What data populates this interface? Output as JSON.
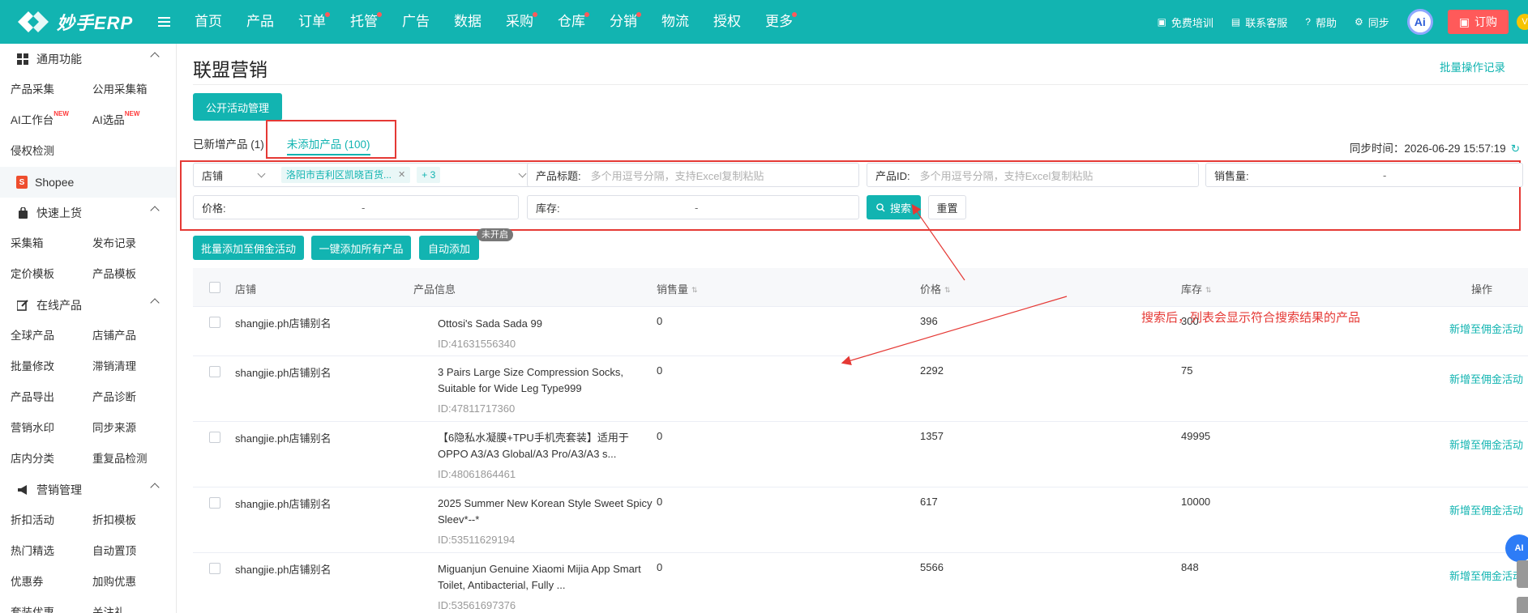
{
  "app": {
    "logo_text": "妙手ERP"
  },
  "nav": {
    "items": [
      {
        "label": "首页",
        "dot": false
      },
      {
        "label": "产品",
        "dot": false
      },
      {
        "label": "订单",
        "dot": true
      },
      {
        "label": "托管",
        "dot": true
      },
      {
        "label": "广告",
        "dot": false
      },
      {
        "label": "数据",
        "dot": false
      },
      {
        "label": "采购",
        "dot": true
      },
      {
        "label": "仓库",
        "dot": true
      },
      {
        "label": "分销",
        "dot": true
      },
      {
        "label": "物流",
        "dot": false
      },
      {
        "label": "授权",
        "dot": false
      },
      {
        "label": "更多",
        "dot": true
      }
    ],
    "right": {
      "training": "免费培训",
      "support": "联系客服",
      "help": "帮助",
      "sync": "同步",
      "ai_label": "Ai",
      "order": "订购",
      "vip": "V"
    },
    "accent_color": "#12b4b1"
  },
  "sidebar": {
    "sections": [
      {
        "title": "通用功能",
        "icon": "grid-icon",
        "links": [
          {
            "label": "产品采集"
          },
          {
            "label": "公用采集箱"
          },
          {
            "label": "AI工作台",
            "badge": "NEW"
          },
          {
            "label": "AI选品",
            "badge": "NEW"
          }
        ],
        "extra": "侵权检测"
      },
      {
        "title": "Shopee",
        "icon": "shopee-icon",
        "platform": true
      },
      {
        "title": "快速上货",
        "icon": "bag-icon",
        "links": [
          {
            "label": "采集箱"
          },
          {
            "label": "发布记录"
          },
          {
            "label": "定价模板"
          },
          {
            "label": "产品模板"
          }
        ]
      },
      {
        "title": "在线产品",
        "icon": "edit-icon",
        "links": [
          {
            "label": "全球产品"
          },
          {
            "label": "店铺产品"
          },
          {
            "label": "批量修改"
          },
          {
            "label": "滞销清理"
          },
          {
            "label": "产品导出"
          },
          {
            "label": "产品诊断"
          },
          {
            "label": "营销水印"
          },
          {
            "label": "同步来源"
          },
          {
            "label": "店内分类"
          },
          {
            "label": "重复品检测"
          }
        ]
      },
      {
        "title": "营销管理",
        "icon": "megaphone-icon",
        "links": [
          {
            "label": "折扣活动"
          },
          {
            "label": "折扣模板"
          },
          {
            "label": "热门精选"
          },
          {
            "label": "自动置顶"
          },
          {
            "label": "优惠券"
          },
          {
            "label": "加购优惠"
          },
          {
            "label": "套装优惠"
          },
          {
            "label": "关注礼"
          }
        ]
      }
    ]
  },
  "main": {
    "title": "联盟营销",
    "batch_log": "批量操作记录",
    "public_activity_button": "公开活动管理",
    "tabs": [
      {
        "label": "已新增产品 (1)",
        "active": false
      },
      {
        "label": "未添加产品 (100)",
        "active": true
      }
    ],
    "sync_time_label": "同步时间：",
    "sync_time_value": "2026-06-29 15:57:19",
    "filters": {
      "store_label": "店铺",
      "store_tag": "洛阳市吉利区凯晓百货...",
      "store_more": "+ 3",
      "title_label": "产品标题:",
      "title_placeholder": "多个用逗号分隔，支持Excel复制粘贴",
      "id_label": "产品ID:",
      "id_placeholder": "多个用逗号分隔，支持Excel复制粘贴",
      "sales_label": "销售量:",
      "price_label": "价格:",
      "stock_label": "库存:",
      "range_sep": "-",
      "search": "搜索",
      "reset": "重置"
    },
    "actions": {
      "batch_add": "批量添加至佣金活动",
      "add_all": "一键添加所有产品",
      "auto_add": "自动添加",
      "auto_badge": "未开启"
    },
    "table": {
      "headers": {
        "store": "店铺",
        "product": "产品信息",
        "sales": "销售量",
        "price": "价格",
        "stock": "库存",
        "op": "操作"
      },
      "rows": [
        {
          "store": "shangjie.ph店铺别名",
          "title": "Ottosi's Sada Sada 99",
          "id": "ID:41631556340",
          "sales": "0",
          "price": "396",
          "stock": "300",
          "action": "新增至佣金活动"
        },
        {
          "store": "shangjie.ph店铺别名",
          "title": "3 Pairs Large Size Compression Socks, Suitable for Wide Leg Type999",
          "id": "ID:47811717360",
          "sales": "0",
          "price": "2292",
          "stock": "75",
          "action": "新增至佣金活动"
        },
        {
          "store": "shangjie.ph店铺别名",
          "title": "【6隐私水凝膜+TPU手机壳套装】适用于OPPO A3/A3 Global/A3 Pro/A3/A3 s...",
          "id": "ID:48061864461",
          "sales": "0",
          "price": "1357",
          "stock": "49995",
          "action": "新增至佣金活动"
        },
        {
          "store": "shangjie.ph店铺别名",
          "title": "2025 Summer New Korean Style Sweet Spicy Sleev*--*",
          "id": "ID:53511629194",
          "sales": "0",
          "price": "617",
          "stock": "10000",
          "action": "新增至佣金活动"
        },
        {
          "store": "shangjie.ph店铺别名",
          "title": "Miguanjun Genuine Xiaomi Mijia App Smart Toilet, Antibacterial, Fully ...",
          "id": "ID:53561697376",
          "sales": "0",
          "price": "5566",
          "stock": "848",
          "action": "新增至佣金活动"
        }
      ]
    },
    "annotation": "搜索后，列表会显示符合搜索结果的产品",
    "float_ai": "AI"
  }
}
